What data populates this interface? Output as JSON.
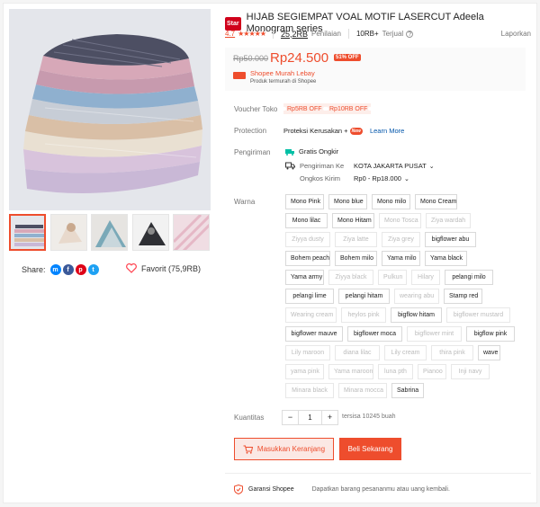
{
  "product": {
    "badge": "Star",
    "title": "HIJAB SEGIEMPAT VOAL MOTIF LASERCUT Adeela Monogram series",
    "rating": "4.7",
    "ratings_count": "25,2RB",
    "ratings_label": "Penilaian",
    "sold_count": "10RB+",
    "sold_label": "Terjual",
    "report": "Laporkan"
  },
  "price": {
    "original": "Rp50.000",
    "current": "Rp24.500",
    "discount": "51% OFF",
    "promo_title": "Shopee Murah Lebay",
    "promo_sub": "Produk termurah di Shopee"
  },
  "voucher": {
    "label": "Voucher Toko",
    "items": [
      "Rp5RB OFF",
      "Rp10RB OFF"
    ]
  },
  "protection": {
    "label": "Protection",
    "value": "Proteksi Kerusakan +",
    "new_badge": "New",
    "link": "Learn More"
  },
  "shipping": {
    "label": "Pengiriman",
    "free": "Gratis Ongkir",
    "to_label": "Pengiriman Ke",
    "to_value": "KOTA JAKARTA PUSAT",
    "cost_label": "Ongkos Kirim",
    "cost_value": "Rp0 - Rp18.000"
  },
  "variants": {
    "label": "Warna",
    "rows": [
      [
        {
          "t": "Mono Pink",
          "d": false
        },
        {
          "t": "Mono blue",
          "d": false
        },
        {
          "t": "Mono milo",
          "d": false
        },
        {
          "t": "Mono Cream",
          "d": false
        }
      ],
      [
        {
          "t": "Mono lilac",
          "d": false
        },
        {
          "t": "Mono Hitam",
          "d": false
        },
        {
          "t": "Mono Tosca",
          "d": true
        },
        {
          "t": "Ziya wardah",
          "d": true
        }
      ],
      [
        {
          "t": "Ziyya dusty",
          "d": true
        },
        {
          "t": "Ziya latte",
          "d": true
        },
        {
          "t": "Ziya grey",
          "d": true
        },
        {
          "t": "bigflower abu",
          "d": false
        }
      ],
      [
        {
          "t": "Bohem peach",
          "d": false
        },
        {
          "t": "Bohem milo",
          "d": false
        },
        {
          "t": "Yama milo",
          "d": false
        },
        {
          "t": "Yama black",
          "d": false
        }
      ],
      [
        {
          "t": "Yama army",
          "d": false
        },
        {
          "t": "Ziyya black",
          "d": true
        },
        {
          "t": "Pulkun",
          "d": true
        },
        {
          "t": "Hilary",
          "d": true
        },
        {
          "t": "pelangi milo",
          "d": false
        }
      ],
      [
        {
          "t": "pelangi lime",
          "d": false
        },
        {
          "t": "pelangi hitam",
          "d": false
        },
        {
          "t": "wearing abu",
          "d": true
        },
        {
          "t": "Stamp red",
          "d": false
        }
      ],
      [
        {
          "t": "Wearing cream",
          "d": true
        },
        {
          "t": "heylos pink",
          "d": true
        },
        {
          "t": "bigflow hitam",
          "d": false
        },
        {
          "t": "bigflower mustard",
          "d": true
        }
      ],
      [
        {
          "t": "bigflower mauve",
          "d": false
        },
        {
          "t": "bigflower moca",
          "d": false
        },
        {
          "t": "bigflower mint",
          "d": true
        },
        {
          "t": "bigflow pink",
          "d": false
        }
      ],
      [
        {
          "t": "Lily maroon",
          "d": true
        },
        {
          "t": "diana lilac",
          "d": true
        },
        {
          "t": "Lily cream",
          "d": true
        },
        {
          "t": "thira pink",
          "d": true
        },
        {
          "t": "wave",
          "d": false
        }
      ],
      [
        {
          "t": "yama pink",
          "d": true
        },
        {
          "t": "Yama maroon",
          "d": true
        },
        {
          "t": "luna pth",
          "d": true
        },
        {
          "t": "Pianoo",
          "d": true
        },
        {
          "t": "Inji navy",
          "d": true
        }
      ],
      [
        {
          "t": "Minara black",
          "d": true
        },
        {
          "t": "Minara mocca",
          "d": true
        },
        {
          "t": "Sabrina",
          "d": false
        }
      ]
    ]
  },
  "quantity": {
    "label": "Kuantitas",
    "value": "1",
    "minus": "−",
    "plus": "+",
    "stock": "tersisa 10245 buah"
  },
  "actions": {
    "cart": "Masukkan Keranjang",
    "buy": "Beli Sekarang"
  },
  "guarantee": {
    "title": "Garansi Shopee",
    "desc": "Dapatkan barang pesananmu atau uang kembali."
  },
  "share": {
    "label": "Share:"
  },
  "favorite": {
    "label": "Favorit (75,9RB)"
  },
  "colors": {
    "accent": "#ee4d2d"
  }
}
